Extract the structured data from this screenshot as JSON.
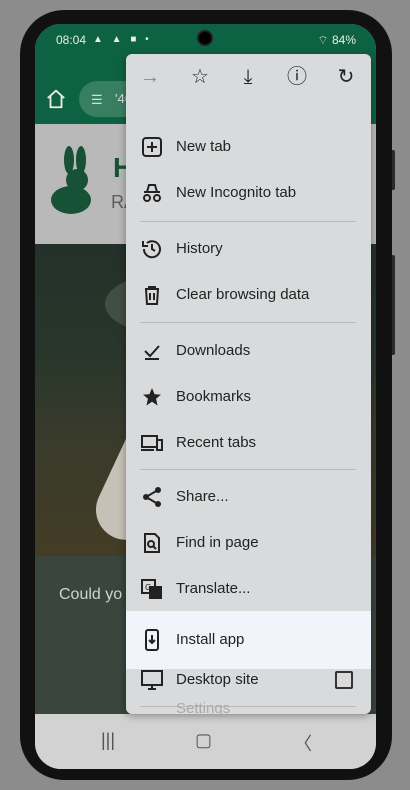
{
  "status": {
    "time": "08:04",
    "right_text": "84%"
  },
  "browser": {
    "url_fragment": "'46"
  },
  "page": {
    "heading_partial": "H",
    "sub_partial": "RA",
    "caption_partial": "Could yo"
  },
  "menu": {
    "top_icons": [
      "forward-icon",
      "star-icon",
      "download-icon",
      "info-icon",
      "refresh-icon"
    ],
    "items": [
      {
        "label": "New tab",
        "icon": "plus-box-icon"
      },
      {
        "label": "New Incognito tab",
        "icon": "incognito-icon"
      },
      {
        "label": "History",
        "icon": "history-icon"
      },
      {
        "label": "Clear browsing data",
        "icon": "trash-icon"
      },
      {
        "label": "Downloads",
        "icon": "downloads-icon"
      },
      {
        "label": "Bookmarks",
        "icon": "star-filled-icon"
      },
      {
        "label": "Recent tabs",
        "icon": "devices-icon"
      },
      {
        "label": "Share...",
        "icon": "share-icon"
      },
      {
        "label": "Find in page",
        "icon": "find-icon"
      },
      {
        "label": "Translate...",
        "icon": "translate-icon"
      },
      {
        "label": "Install app",
        "icon": "install-app-icon",
        "highlighted": true
      },
      {
        "label": "Desktop site",
        "icon": "desktop-icon",
        "checkbox": false
      },
      {
        "label": "Settings",
        "icon": "settings-icon"
      }
    ]
  },
  "colors": {
    "toolbar": "#0f6b49",
    "menu_bg": "#d8dadc",
    "highlight": "#f1f4fb"
  }
}
